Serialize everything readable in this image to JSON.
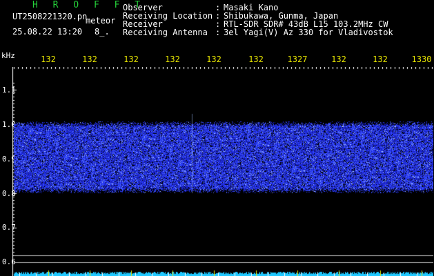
{
  "app": {
    "title": "H R O F F T",
    "filename": "UT2508221320.pn_",
    "datetime": "25.08.22 13:20",
    "tag": "meteor",
    "code": "8_."
  },
  "info": [
    {
      "label": "Observer",
      "sep": ":",
      "value": "Masaki Kano"
    },
    {
      "label": "Receiving Location",
      "sep": ":",
      "value": "Shibukawa, Gunma, Japan"
    },
    {
      "label": "Receiver",
      "sep": ":",
      "value": "RTL-SDR SDR# 43dB L15 103.2MHz CW"
    },
    {
      "label": "Receiving Antenna",
      "sep": ":",
      "value": "3el Yagi(V) Az 330 for Vladivostok"
    }
  ],
  "axes": {
    "y_unit": "kHz",
    "y_ticks": [
      "1.1",
      "1.0",
      "0.9",
      "0.8",
      "0.7",
      "0.6"
    ],
    "x_ticks": [
      "132",
      "132",
      "132",
      "132",
      "132",
      "132",
      "1327",
      "132",
      "132",
      "1330"
    ]
  },
  "colors": {
    "background": "#000000",
    "title": "#25d23a",
    "tick_labels": "#e8e600",
    "signal": "#2a3cff",
    "floor": "#1ec8ff"
  },
  "waterfall": {
    "band_top_khz": 1.01,
    "band_bottom_khz": 0.8,
    "y_min_khz": 0.58,
    "y_max_khz": 1.12
  }
}
